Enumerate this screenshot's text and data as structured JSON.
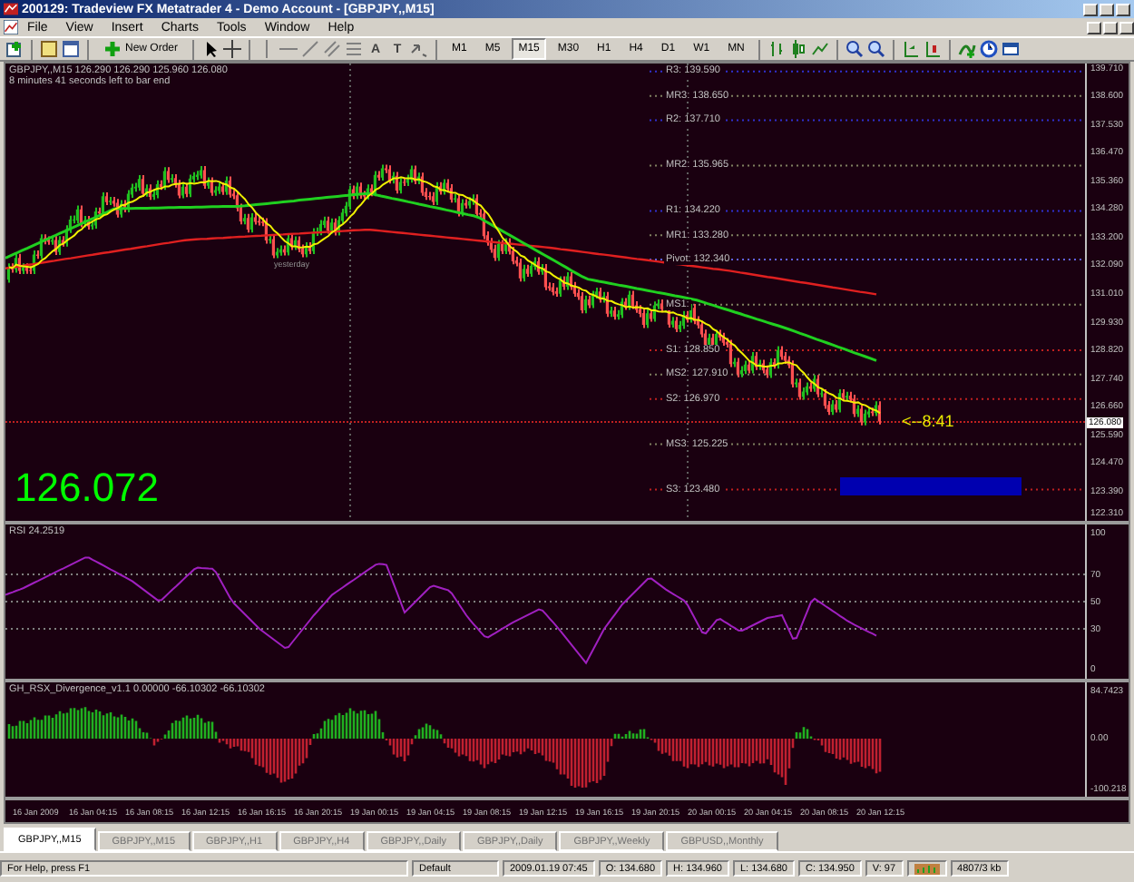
{
  "window": {
    "title": "200129: Tradeview FX Metatrader 4 - Demo Account - [GBPJPY,,M15]"
  },
  "menu": [
    "File",
    "View",
    "Insert",
    "Charts",
    "Tools",
    "Window",
    "Help"
  ],
  "toolbar": {
    "new_order": "New Order",
    "text_tool": "A",
    "label_tool": "T",
    "periods": [
      {
        "label": "M1",
        "selected": false
      },
      {
        "label": "M5",
        "selected": false
      },
      {
        "label": "M15",
        "selected": true
      },
      {
        "label": "M30",
        "selected": false
      },
      {
        "label": "H1",
        "selected": false
      },
      {
        "label": "H4",
        "selected": false
      },
      {
        "label": "D1",
        "selected": false
      },
      {
        "label": "W1",
        "selected": false
      },
      {
        "label": "MN",
        "selected": false
      }
    ]
  },
  "chart": {
    "header": [
      "GBPJPY,,M15  126.290 126.290 125.960 126.080",
      "8 minutes 41 seconds left to bar end"
    ],
    "yesterday_label": "yesterday",
    "pivots": [
      {
        "kind": "resistance",
        "label": "R3: 139.590"
      },
      {
        "kind": "mid",
        "label": "MR3: 138.650"
      },
      {
        "kind": "resistance",
        "label": "R2: 137.710"
      },
      {
        "kind": "mid",
        "label": "MR2: 135.965"
      },
      {
        "kind": "resistance",
        "label": "R1: 134.220"
      },
      {
        "kind": "mid",
        "label": "MR1: 133.280"
      },
      {
        "kind": "pivot",
        "label": "Pivot: 132.340"
      },
      {
        "kind": "mid",
        "label": "MS1:"
      },
      {
        "kind": "support",
        "label": "S1: 128.850"
      },
      {
        "kind": "mid",
        "label": "MS2: 127.910"
      },
      {
        "kind": "support",
        "label": "S2: 126.970"
      },
      {
        "kind": "mid",
        "label": "MS3: 125.225"
      },
      {
        "kind": "support",
        "label": "S3: 123.480"
      }
    ],
    "price_axis": [
      "139.710",
      "138.600",
      "137.530",
      "136.470",
      "135.360",
      "134.280",
      "133.200",
      "132.090",
      "131.010",
      "129.930",
      "128.820",
      "127.740",
      "126.660",
      "125.590",
      "124.470",
      "123.390",
      "122.310"
    ],
    "current_price": "126.080",
    "big_price": "126.072",
    "countdown": "<--8:41",
    "rsi": {
      "label": "RSI 24.2519",
      "axis": [
        "100",
        "70",
        "50",
        "30",
        "0"
      ]
    },
    "divergence": {
      "label": "GH_RSX_Divergence_v1.1 0.00000 -66.10302 -66.10302",
      "axis": [
        "84.7423",
        "0.00",
        "-100.218"
      ]
    },
    "time_axis": [
      "16 Jan 2009",
      "16 Jan 04:15",
      "16 Jan 08:15",
      "16 Jan 12:15",
      "16 Jan 16:15",
      "16 Jan 20:15",
      "19 Jan 00:15",
      "19 Jan 04:15",
      "19 Jan 08:15",
      "19 Jan 12:15",
      "19 Jan 16:15",
      "19 Jan 20:15",
      "20 Jan 00:15",
      "20 Jan 04:15",
      "20 Jan 08:15",
      "20 Jan 12:15"
    ]
  },
  "tabs": [
    {
      "label": "GBPJPY,,M15",
      "selected": true
    },
    {
      "label": "GBPJPY,,M15",
      "selected": false
    },
    {
      "label": "GBPJPY,,H1",
      "selected": false
    },
    {
      "label": "GBPJPY,,H4",
      "selected": false
    },
    {
      "label": "GBPJPY,,Daily",
      "selected": false
    },
    {
      "label": "GBPJPY,,Daily",
      "selected": false
    },
    {
      "label": "GBPJPY,,Weekly",
      "selected": false
    },
    {
      "label": "GBPUSD,,Monthly",
      "selected": false
    }
  ],
  "status_bar": {
    "help": "For Help, press F1",
    "profile": "Default",
    "time": "2009.01.19 07:45",
    "open": "O: 134.680",
    "high": "H: 134.960",
    "low": "L: 134.680",
    "close": "C: 134.950",
    "volume": "V: 97",
    "traffic": "4807/3 kb"
  }
}
